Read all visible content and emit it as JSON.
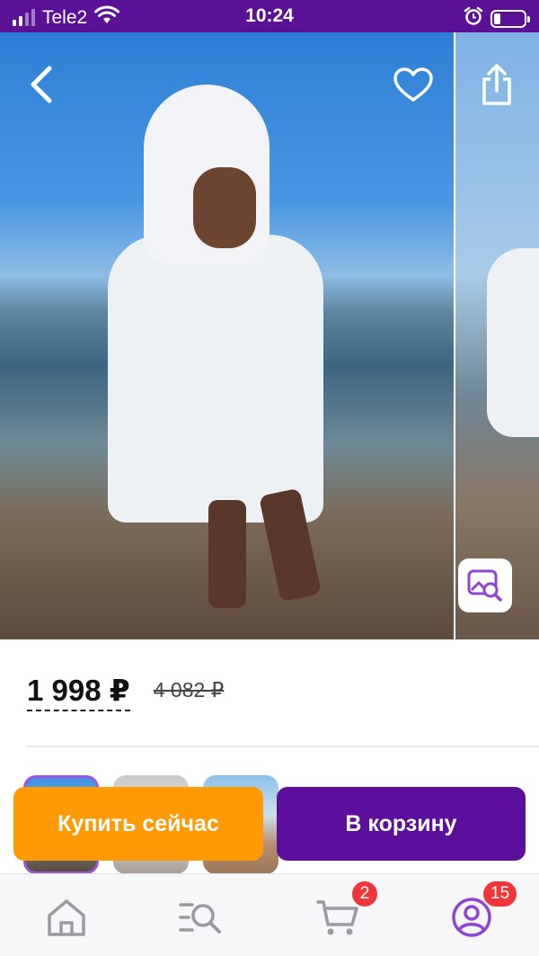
{
  "status_bar": {
    "carrier": "Tele2",
    "time": "10:24",
    "icons": [
      "signal-icon",
      "wifi-icon",
      "alarm-icon",
      "battery-icon"
    ]
  },
  "gallery": {
    "icons": {
      "back": "chevron-left-icon",
      "favorite": "heart-icon",
      "share": "share-icon",
      "image_search": "image-search-icon"
    }
  },
  "product": {
    "price": "1 998 ₽",
    "old_price": "4 082 ₽"
  },
  "actions": {
    "buy_now": "Купить сейчас",
    "add_to_cart": "В корзину"
  },
  "tabbar": {
    "items": [
      {
        "name": "home",
        "icon": "home-icon"
      },
      {
        "name": "catalog",
        "icon": "search-list-icon"
      },
      {
        "name": "cart",
        "icon": "cart-icon",
        "badge": "2"
      },
      {
        "name": "profile",
        "icon": "profile-icon",
        "badge": "15"
      }
    ]
  },
  "colors": {
    "brand_purple": "#5c0f9b",
    "buy_orange": "#ff9a05",
    "badge_red": "#f0363b"
  }
}
